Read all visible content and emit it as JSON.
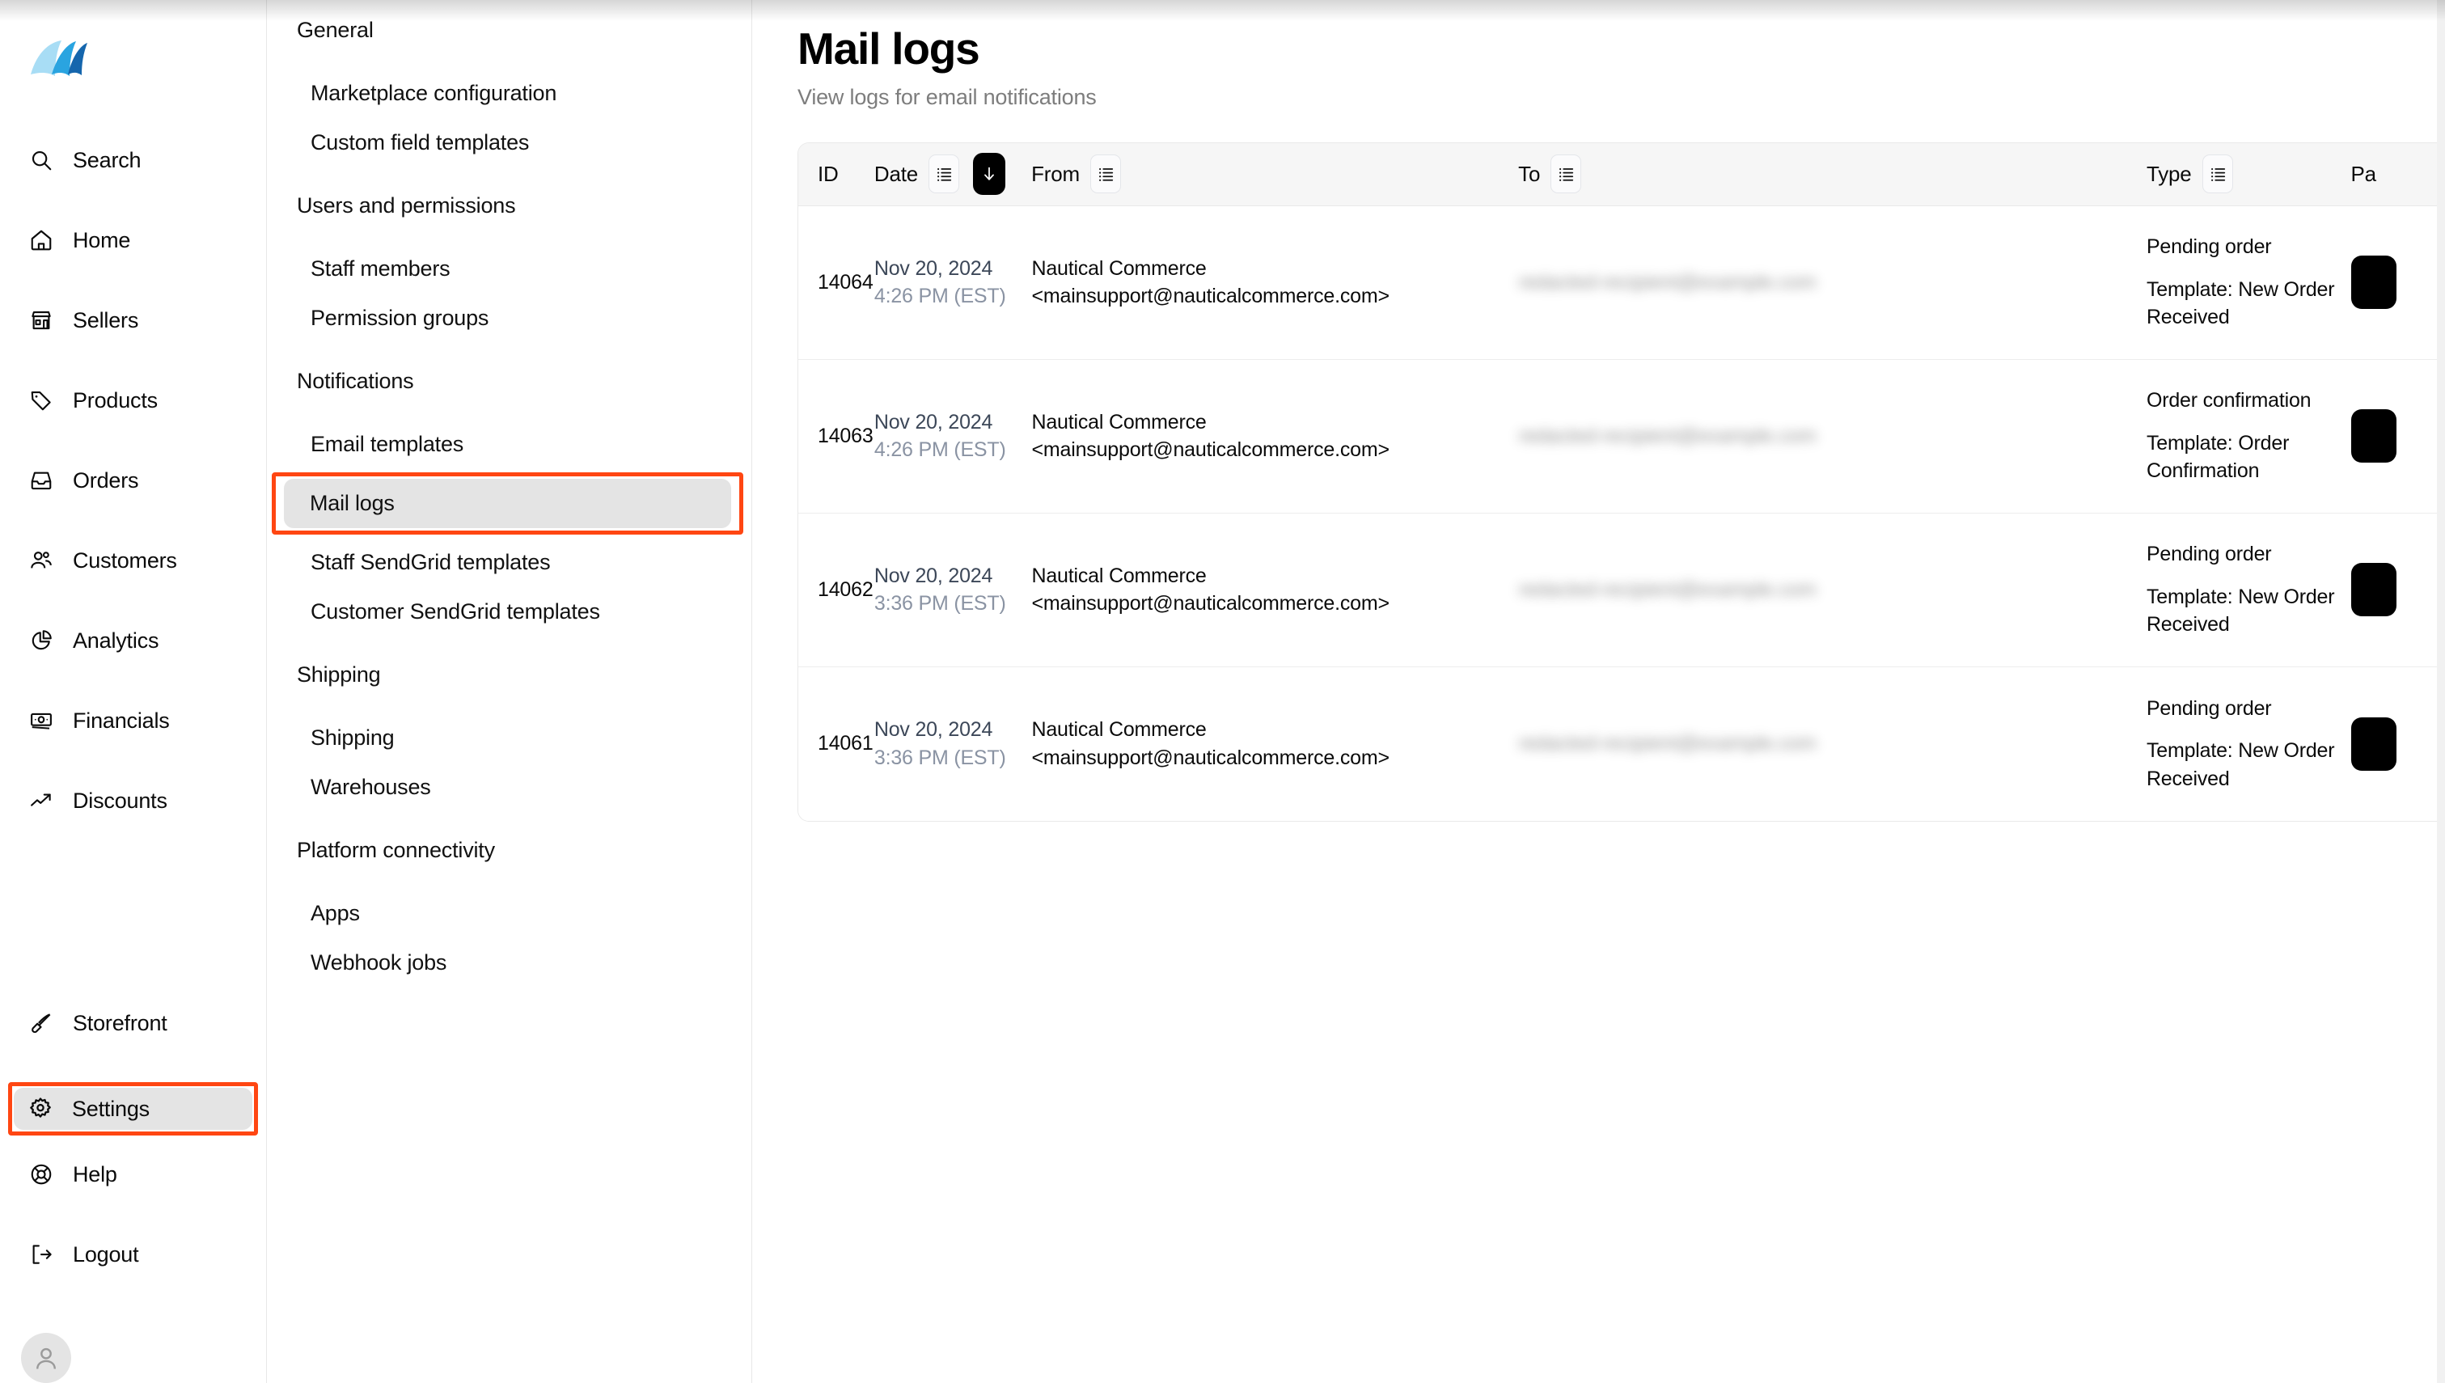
{
  "brand": {
    "logo_name": "nautical-sails-logo",
    "accent": "#0d7fc4",
    "highlight": "#ff4612"
  },
  "sidebar": {
    "items": [
      {
        "label": "Search",
        "icon": "search-icon",
        "active": false
      },
      {
        "label": "Home",
        "icon": "home-icon",
        "active": false
      },
      {
        "label": "Sellers",
        "icon": "store-icon",
        "active": false
      },
      {
        "label": "Products",
        "icon": "tag-icon",
        "active": false
      },
      {
        "label": "Orders",
        "icon": "inbox-icon",
        "active": false
      },
      {
        "label": "Customers",
        "icon": "users-icon",
        "active": false
      },
      {
        "label": "Analytics",
        "icon": "pie-chart-icon",
        "active": false
      },
      {
        "label": "Financials",
        "icon": "banknote-icon",
        "active": false
      },
      {
        "label": "Discounts",
        "icon": "trending-up-icon",
        "active": false
      }
    ],
    "bottom_items": [
      {
        "label": "Storefront",
        "icon": "paintbrush-icon",
        "active": false,
        "highlighted": false
      },
      {
        "label": "Settings",
        "icon": "gear-icon",
        "active": true,
        "highlighted": true
      },
      {
        "label": "Help",
        "icon": "lifebuoy-icon",
        "active": false,
        "highlighted": false
      },
      {
        "label": "Logout",
        "icon": "logout-icon",
        "active": false,
        "highlighted": false
      }
    ],
    "avatar_icon": "user-avatar-icon"
  },
  "settings_nav": [
    {
      "type": "section",
      "label": "General"
    },
    {
      "type": "item",
      "label": "Marketplace configuration",
      "active": false,
      "highlighted": false
    },
    {
      "type": "item",
      "label": "Custom field templates",
      "active": false,
      "highlighted": false
    },
    {
      "type": "section",
      "label": "Users and permissions"
    },
    {
      "type": "item",
      "label": "Staff members",
      "active": false,
      "highlighted": false
    },
    {
      "type": "item",
      "label": "Permission groups",
      "active": false,
      "highlighted": false
    },
    {
      "type": "section",
      "label": "Notifications"
    },
    {
      "type": "item",
      "label": "Email templates",
      "active": false,
      "highlighted": false
    },
    {
      "type": "item",
      "label": "Mail logs",
      "active": true,
      "highlighted": true
    },
    {
      "type": "item",
      "label": "Staff SendGrid templates",
      "active": false,
      "highlighted": false
    },
    {
      "type": "item",
      "label": "Customer SendGrid templates",
      "active": false,
      "highlighted": false
    },
    {
      "type": "section",
      "label": "Shipping"
    },
    {
      "type": "item",
      "label": "Shipping",
      "active": false,
      "highlighted": false
    },
    {
      "type": "item",
      "label": "Warehouses",
      "active": false,
      "highlighted": false
    },
    {
      "type": "section",
      "label": "Platform connectivity"
    },
    {
      "type": "item",
      "label": "Apps",
      "active": false,
      "highlighted": false
    },
    {
      "type": "item",
      "label": "Webhook jobs",
      "active": false,
      "highlighted": false
    }
  ],
  "page": {
    "title": "Mail logs",
    "subtitle": "View logs for email notifications"
  },
  "table": {
    "columns": [
      {
        "key": "id",
        "label": "ID",
        "filter": false,
        "sort": null
      },
      {
        "key": "date",
        "label": "Date",
        "filter": true,
        "sort": "desc"
      },
      {
        "key": "from",
        "label": "From",
        "filter": true,
        "sort": null
      },
      {
        "key": "to",
        "label": "To",
        "filter": true,
        "sort": null
      },
      {
        "key": "type",
        "label": "Type",
        "filter": true,
        "sort": null
      },
      {
        "key": "payload",
        "label": "Pa",
        "filter": false,
        "sort": null
      }
    ],
    "rows": [
      {
        "id": "14064",
        "date_primary": "Nov 20, 2024",
        "date_secondary": "4:26 PM (EST)",
        "from_name": "Nautical Commerce",
        "from_email": "<mainsupport@nauticalcommerce.com>",
        "to": "redacted-recipient@example.com",
        "type": "Pending order",
        "template": "Template: New Order Received"
      },
      {
        "id": "14063",
        "date_primary": "Nov 20, 2024",
        "date_secondary": "4:26 PM (EST)",
        "from_name": "Nautical Commerce",
        "from_email": "<mainsupport@nauticalcommerce.com>",
        "to": "redacted-recipient@example.com",
        "type": "Order confirmation",
        "template": "Template: Order Confirmation"
      },
      {
        "id": "14062",
        "date_primary": "Nov 20, 2024",
        "date_secondary": "3:36 PM (EST)",
        "from_name": "Nautical Commerce",
        "from_email": "<mainsupport@nauticalcommerce.com>",
        "to": "redacted-recipient@example.com",
        "type": "Pending order",
        "template": "Template: New Order Received"
      },
      {
        "id": "14061",
        "date_primary": "Nov 20, 2024",
        "date_secondary": "3:36 PM (EST)",
        "from_name": "Nautical Commerce",
        "from_email": "<mainsupport@nauticalcommerce.com>",
        "to": "redacted-recipient@example.com",
        "type": "Pending order",
        "template": "Template: New Order Received"
      }
    ]
  }
}
